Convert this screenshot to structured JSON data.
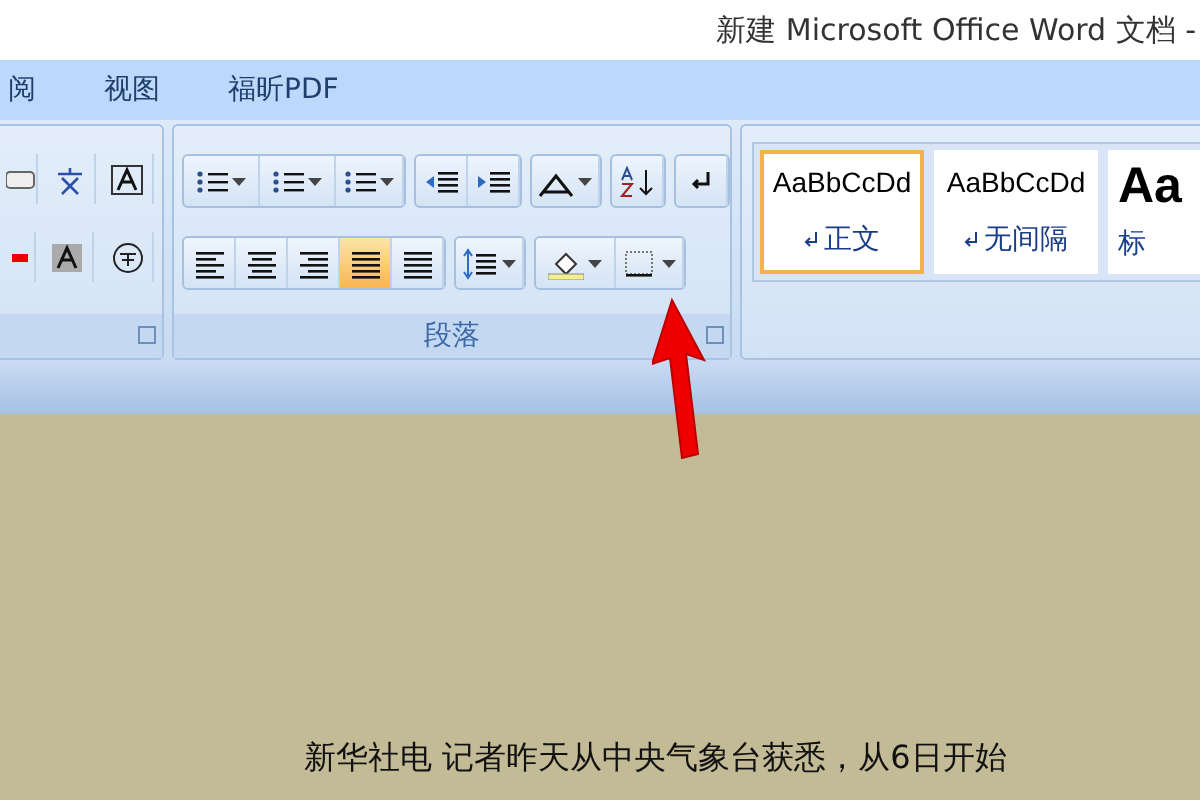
{
  "window": {
    "title": "新建 Microsoft Office Word 文档 -"
  },
  "tabs": [
    {
      "label": "阅",
      "selected": false
    },
    {
      "label": "视图",
      "selected": false
    },
    {
      "label": "福昕PDF",
      "selected": false
    }
  ],
  "paragraph_group": {
    "label": "段落",
    "alignment": [
      {
        "kind": "left",
        "selected": false
      },
      {
        "kind": "center",
        "selected": false
      },
      {
        "kind": "right",
        "selected": false
      },
      {
        "kind": "justify",
        "selected": true
      },
      {
        "kind": "distributed",
        "selected": false
      }
    ]
  },
  "styles": [
    {
      "preview": "AaBbCcDd",
      "label": "正文",
      "kind": "normal",
      "selected": true
    },
    {
      "preview": "AaBbCcDd",
      "label": "无间隔",
      "kind": "normal",
      "selected": false
    },
    {
      "preview": "Aa",
      "label": "标",
      "kind": "heading",
      "selected": false
    }
  ],
  "document": {
    "text": "新华社电  记者昨天从中央气象台获悉，从6日开始"
  }
}
